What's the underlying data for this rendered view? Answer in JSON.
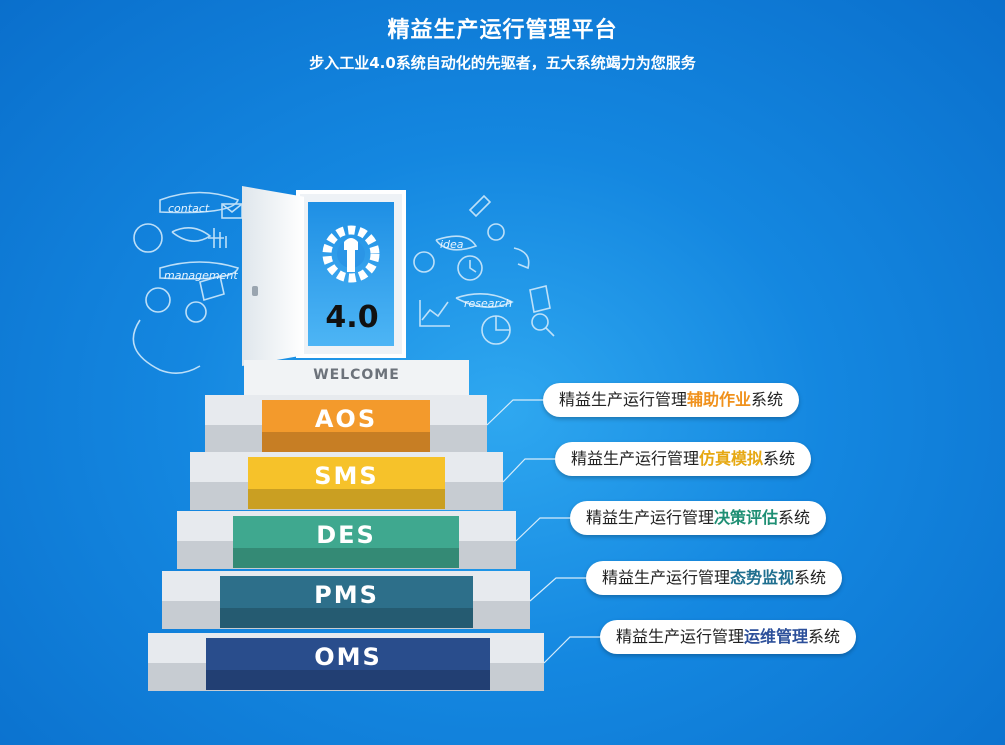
{
  "header": {
    "title": "精益生产运行管理平台",
    "subtitle": "步入工业4.0系统自动化的先驱者，五大系统竭力为您服务"
  },
  "door": {
    "version": "4.0",
    "welcome": "WELCOME"
  },
  "doodles": {
    "contact": "contact",
    "management": "management",
    "idea": "idea",
    "research": "research"
  },
  "steps": [
    {
      "code": "AOS",
      "color": "#f39a2c",
      "prefix": "精益生产运行管理",
      "highlight": "辅助作业",
      "suffix": "系统",
      "hl_color": "#f0911c"
    },
    {
      "code": "SMS",
      "color": "#f6c22a",
      "prefix": "精益生产运行管理",
      "highlight": "仿真模拟",
      "suffix": "系统",
      "hl_color": "#e6a812"
    },
    {
      "code": "DES",
      "color": "#3fa88f",
      "prefix": "精益生产运行管理",
      "highlight": "决策评估",
      "suffix": "系统",
      "hl_color": "#1f8f74"
    },
    {
      "code": "PMS",
      "color": "#2d6f8a",
      "prefix": "精益生产运行管理",
      "highlight": "态势监视",
      "suffix": "系统",
      "hl_color": "#1f6f8f"
    },
    {
      "code": "OMS",
      "color": "#294d8c",
      "prefix": "精益生产运行管理",
      "highlight": "运维管理",
      "suffix": "系统",
      "hl_color": "#2c4f9a"
    }
  ]
}
